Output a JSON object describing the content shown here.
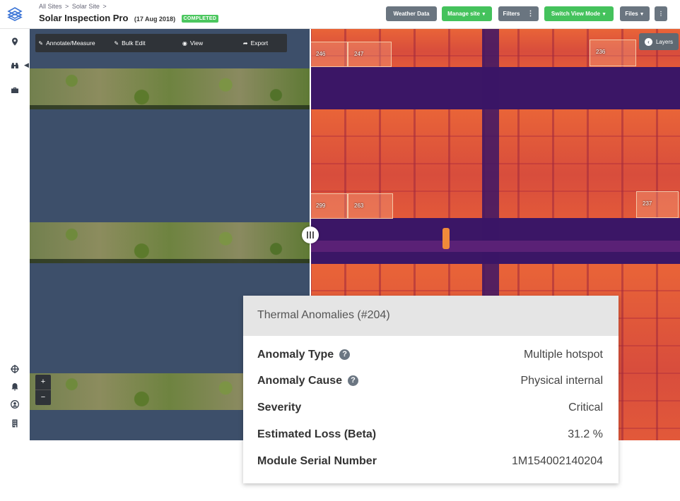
{
  "header": {
    "breadcrumb": [
      "All Sites",
      "Solar Site"
    ],
    "breadcrumb_sep": ">",
    "title": "Solar Inspection Pro",
    "date": "(17 Aug 2018)",
    "status_badge": "COMPLETED",
    "buttons": {
      "weather": "Weather Data",
      "manage": "Manage site",
      "filters": "Filters",
      "switch_view": "Switch View Mode",
      "files": "Files"
    }
  },
  "toolbar": {
    "annotate": "Annotate/Measure",
    "bulk_edit": "Bulk Edit",
    "view": "View",
    "export": "Export"
  },
  "layers_label": "Layers",
  "zoom": {
    "in": "+",
    "out": "−"
  },
  "annotations": [
    "246",
    "247",
    "236",
    "299",
    "263",
    "237"
  ],
  "anomaly_card": {
    "title": "Thermal Anomalies (#204)",
    "rows": [
      {
        "label": "Anomaly Type",
        "value": "Multiple hotspot"
      },
      {
        "label": "Anomaly Cause",
        "value": "Physical internal"
      },
      {
        "label": "Severity",
        "value": "Critical"
      },
      {
        "label": "Estimated Loss (Beta)",
        "value": "31.2 %"
      },
      {
        "label": "Module Serial Number",
        "value": "1M154002140204"
      }
    ]
  },
  "colors": {
    "accent_green": "#44c25c",
    "button_gray": "#6a7580",
    "toolbar_dark": "#2f3338"
  },
  "sidebar_icons": [
    "map-pin-icon",
    "binoculars-icon",
    "briefcase-icon",
    "target-icon",
    "bell-icon",
    "user-icon",
    "building-icon"
  ]
}
